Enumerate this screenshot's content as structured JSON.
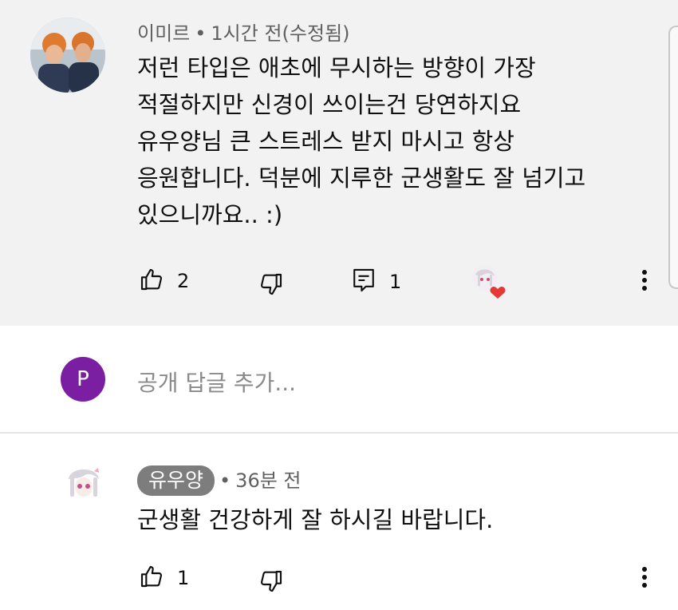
{
  "comment": {
    "author": "이미르",
    "time": "1시간 전(수정됨)",
    "body": "저런 타입은 애초에 무시하는 방향이 가장\n적절하지만 신경이 쓰이는건 당연하지요\n유우양님 큰 스트레스 받지 마시고 항상\n응원합니다. 덕분에 지루한 군생활도 잘 넘기고\n있으니까요.. :)",
    "likes": "2",
    "replies": "1"
  },
  "reply_box": {
    "avatar_letter": "P",
    "placeholder": "공개 답글 추가..."
  },
  "reply": {
    "author": "유우양",
    "time": "36분 전",
    "body": "군생활 건강하게 잘 하시길 바랍니다.",
    "likes": "1"
  },
  "colors": {
    "section_bg": "#f2f2f2",
    "avatar_purple": "#7b1fa2",
    "badge_gray": "#7d7d7d",
    "heart": "#e53935"
  },
  "icons": [
    "thumbs-up-icon",
    "thumbs-down-icon",
    "comment-icon",
    "more-vert-icon",
    "heart-icon"
  ]
}
